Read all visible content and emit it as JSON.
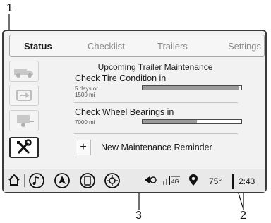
{
  "callouts": {
    "c1": "1",
    "c2": "2",
    "c3": "3"
  },
  "tabs": [
    {
      "label": "Status",
      "active": true
    },
    {
      "label": "Checklist",
      "active": false
    },
    {
      "label": "Trailers",
      "active": false
    },
    {
      "label": "Settings",
      "active": false
    }
  ],
  "rail": [
    {
      "icon": "truck-icon",
      "selected": false
    },
    {
      "icon": "hitch-connect-icon",
      "selected": false
    },
    {
      "icon": "trailer-icon",
      "selected": false
    },
    {
      "icon": "wrench-screwdriver-icon",
      "selected": true
    }
  ],
  "maintenance": {
    "title": "Upcoming Trailer Maintenance",
    "items": [
      {
        "title": "Check Tire Condition in",
        "sub1": "5 days or",
        "sub2": "1500 mi",
        "progress": 0.97
      },
      {
        "title": "Check Wheel Bearings in",
        "sub1": "7000 mi",
        "sub2": "",
        "progress": 0.55
      }
    ],
    "add_label": "New Maintenance Reminder",
    "add_symbol": "+"
  },
  "statusbar": {
    "temperature": "75°",
    "time": "2:43",
    "network": "4G",
    "icons": [
      "home-icon",
      "music-icon",
      "navigation-icon",
      "phone-icon",
      "apps-icon",
      "connectivity-icon",
      "signal-icon",
      "location-icon"
    ]
  },
  "colors": {
    "frame": "#3a3a3a",
    "bar_fill": "#9a9a9a",
    "background": "#f2f2f2"
  }
}
